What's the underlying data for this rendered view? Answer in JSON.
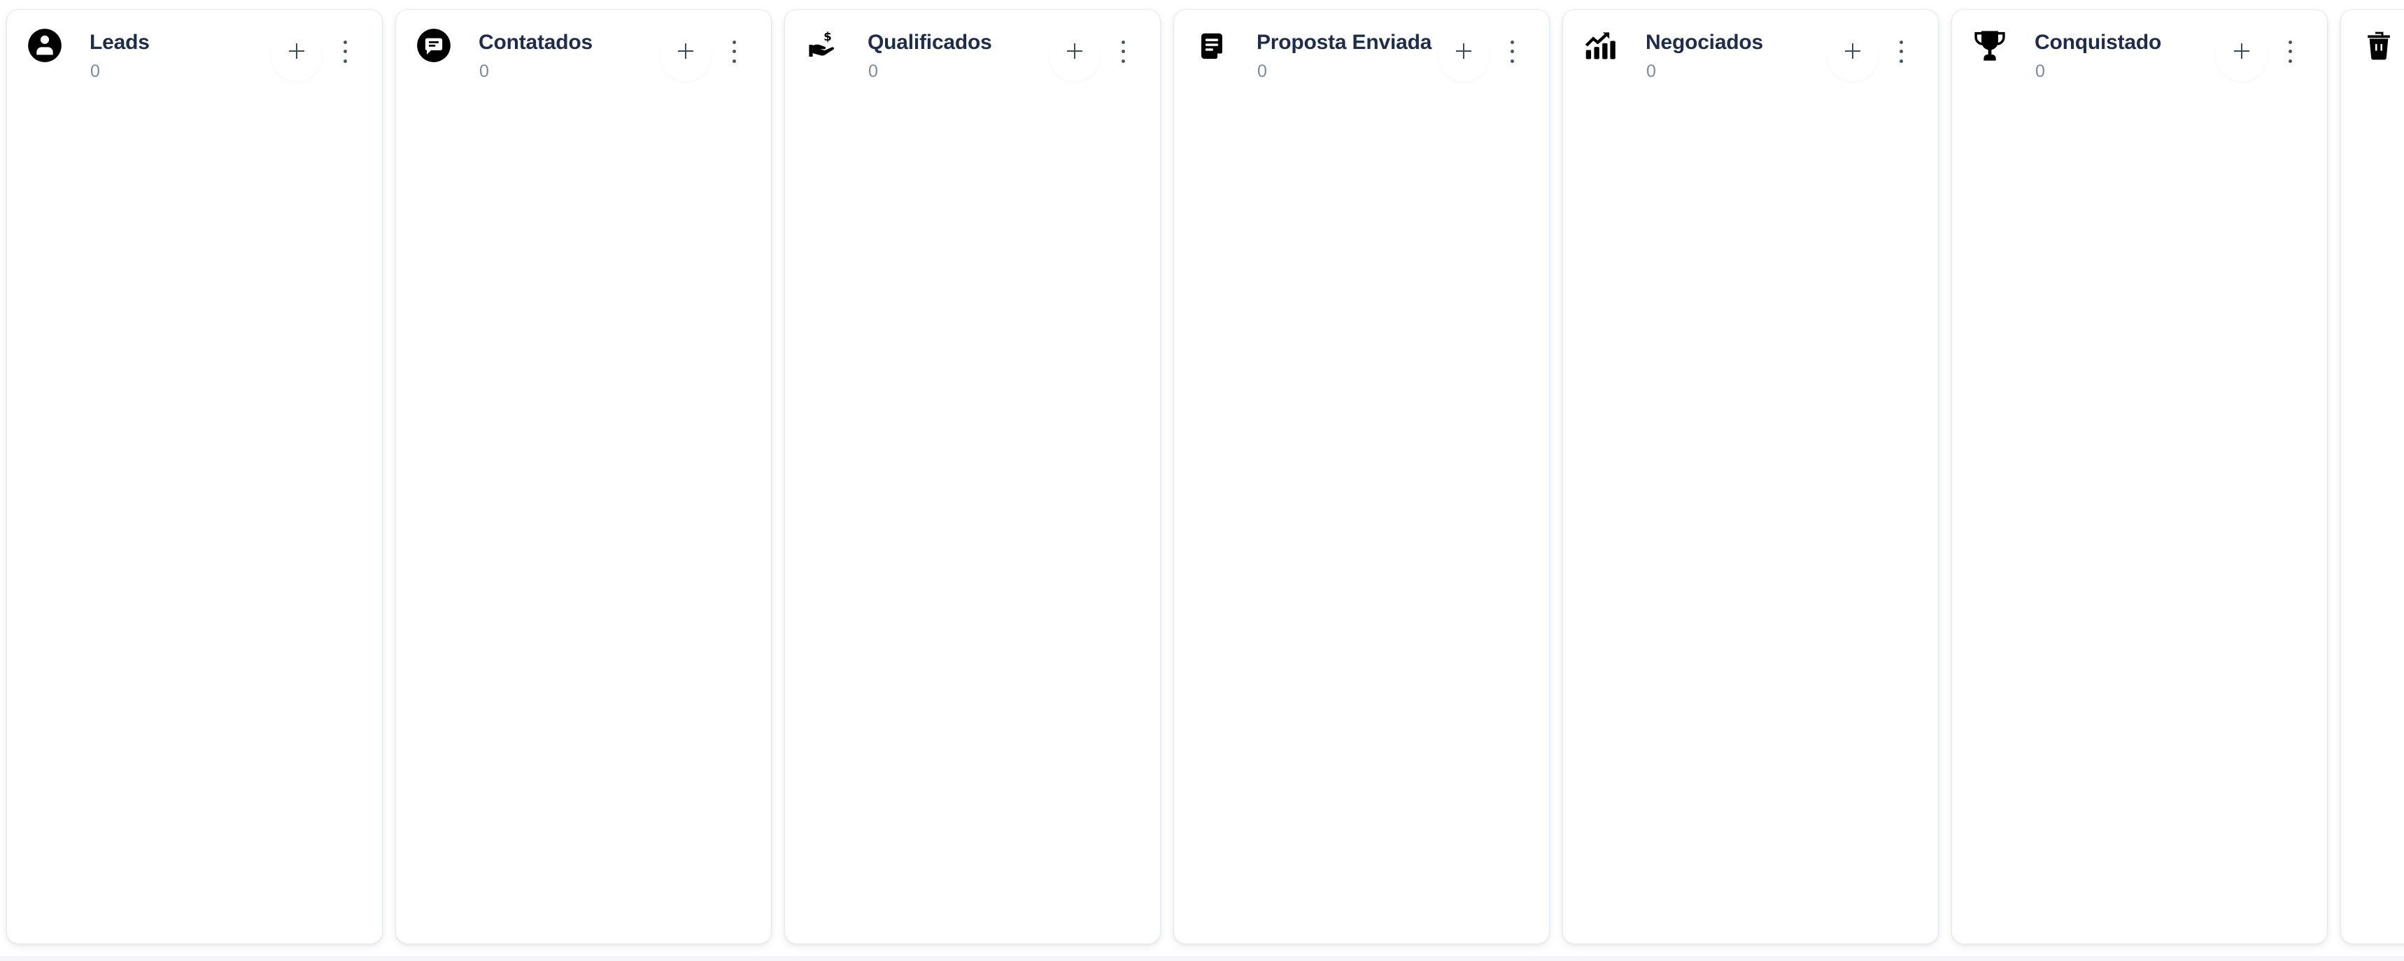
{
  "board": {
    "columns": [
      {
        "title": "Leads",
        "count": "0",
        "icon": "account-circle-icon",
        "add_label": "+",
        "menu_label": "more-options"
      },
      {
        "title": "Contatados",
        "count": "0",
        "icon": "chat-bubble-icon",
        "add_label": "+",
        "menu_label": "more-options"
      },
      {
        "title": "Qualificados",
        "count": "0",
        "icon": "hand-dollar-icon",
        "add_label": "+",
        "menu_label": "more-options"
      },
      {
        "title": "Proposta Enviada",
        "count": "0",
        "icon": "document-icon",
        "add_label": "+",
        "menu_label": "more-options"
      },
      {
        "title": "Negociados",
        "count": "0",
        "icon": "trending-chart-icon",
        "add_label": "+",
        "menu_label": "more-options"
      },
      {
        "title": "Conquistado",
        "count": "0",
        "icon": "trophy-icon",
        "add_label": "+",
        "menu_label": "more-options"
      }
    ],
    "trash_column": {
      "icon": "trash-icon"
    }
  },
  "colors": {
    "title": "#1f2d4d",
    "count": "#7a8aa3",
    "icon": "#000000",
    "control": "#3e4a56"
  }
}
